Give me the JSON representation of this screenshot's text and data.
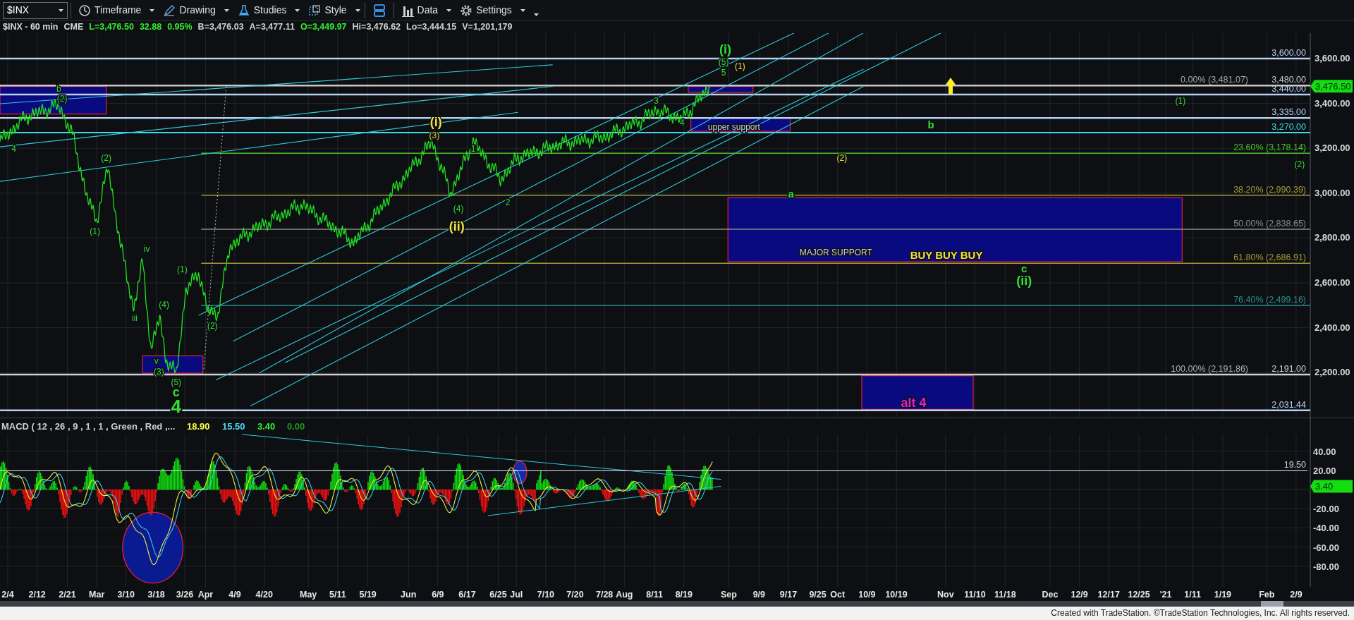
{
  "toolbar": {
    "symbol": "$INX",
    "buttons": [
      {
        "label": "Timeframe"
      },
      {
        "label": "Drawing"
      },
      {
        "label": "Studies"
      },
      {
        "label": "Style"
      },
      {
        "label": "Data"
      },
      {
        "label": "Settings"
      }
    ]
  },
  "quote_bar": {
    "symbol": "$INX - 60 min",
    "exchange": "CME",
    "fields": [
      {
        "text": "L=3,476.50",
        "color": "#33ee33"
      },
      {
        "text": "32.88",
        "color": "#33ee33"
      },
      {
        "text": "0.95%",
        "color": "#33ee33"
      },
      {
        "text": "B=3,476.03",
        "color": "#d0d0d0"
      },
      {
        "text": "A=3,477.11",
        "color": "#d0d0d0"
      },
      {
        "text": "O=3,449.97",
        "color": "#33ee33"
      },
      {
        "text": "Hi=3,476.62",
        "color": "#d0d0d0"
      },
      {
        "text": "Lo=3,444.15",
        "color": "#d0d0d0"
      },
      {
        "text": "V=1,201,179",
        "color": "#d0d0d0"
      }
    ]
  },
  "price_chart": {
    "levels": [
      {
        "label": "3,600.00",
        "color": "#b8d0f0"
      },
      {
        "label": "3,480.00",
        "color": "#c8c8c8"
      },
      {
        "label": "3,440.00",
        "color": "#b8d0f0"
      },
      {
        "label": "3,335.00",
        "color": "#b8d0f0"
      },
      {
        "label": "3,270.00",
        "color": "#40d8e8"
      },
      {
        "label": "2,191.00",
        "color": "#d0d0d0"
      },
      {
        "label": "2,031.44",
        "color": "#b8d0f0"
      }
    ],
    "fib_levels": [
      {
        "label": "0.00% (3,481.07)",
        "color": "#a8a8a8"
      },
      {
        "label": "23.60% (3,178.14)",
        "color": "#4cc02c"
      },
      {
        "label": "38.20% (2,990.39)",
        "color": "#a39a3a"
      },
      {
        "label": "50.00% (2,838.65)",
        "color": "#8a8a8a"
      },
      {
        "label": "61.80% (2,686.91)",
        "color": "#a39a3a"
      },
      {
        "label": "76.40% (2,499.16)",
        "color": "#2a9090"
      },
      {
        "label": "100.00% (2,191.86)",
        "color": "#b0b0b0"
      }
    ],
    "annotations": [
      {
        "text": "4",
        "kind": "small",
        "color": "#33dd33"
      },
      {
        "text": "b",
        "kind": "small",
        "color": "#33dd33"
      },
      {
        "text": "(2)",
        "kind": "small",
        "color": "#33dd33"
      },
      {
        "text": "(2)",
        "kind": "small",
        "color": "#33dd33"
      },
      {
        "text": "(1)",
        "kind": "small",
        "color": "#33dd33"
      },
      {
        "text": "iv",
        "kind": "small",
        "color": "#33dd33"
      },
      {
        "text": "(1)",
        "kind": "small",
        "color": "#33dd33"
      },
      {
        "text": "(4)",
        "kind": "small",
        "color": "#33dd33"
      },
      {
        "text": "iii",
        "kind": "small",
        "color": "#33dd33"
      },
      {
        "text": "v",
        "kind": "small",
        "color": "#33dd33"
      },
      {
        "text": "(3)",
        "kind": "small",
        "color": "#33dd33"
      },
      {
        "text": "(5)",
        "kind": "small",
        "color": "#33dd33"
      },
      {
        "text": "c",
        "kind": "large",
        "color": "#33dd33"
      },
      {
        "text": "4",
        "kind": "xlarge",
        "color": "#33dd33"
      },
      {
        "text": "(2)",
        "kind": "small",
        "color": "#33dd33"
      },
      {
        "text": "(i)",
        "kind": "large",
        "color": "#f0e040"
      },
      {
        "text": "(3)",
        "kind": "small",
        "color": "#d8d040"
      },
      {
        "text": "1",
        "kind": "small",
        "color": "#33dd33"
      },
      {
        "text": "(4)",
        "kind": "small",
        "color": "#33dd33"
      },
      {
        "text": "(ii)",
        "kind": "large",
        "color": "#f0e040"
      },
      {
        "text": "2",
        "kind": "small",
        "color": "#33dd33"
      },
      {
        "text": "3",
        "kind": "small",
        "color": "#33dd33"
      },
      {
        "text": "4",
        "kind": "small",
        "color": "#33dd33"
      },
      {
        "text": "(i)",
        "kind": "large",
        "color": "#33dd33"
      },
      {
        "text": "(5)",
        "kind": "small",
        "color": "#33dd33"
      },
      {
        "text": "5",
        "kind": "small",
        "color": "#33dd33"
      },
      {
        "text": "(1)",
        "kind": "small",
        "color": "#f0e040"
      },
      {
        "text": "upper support",
        "kind": "text",
        "color": "#c8d0e8"
      },
      {
        "text": "b",
        "kind": "bold",
        "color": "#33dd33"
      },
      {
        "text": "(2)",
        "kind": "small",
        "color": "#f0e040"
      },
      {
        "text": "(1)",
        "kind": "small",
        "color": "#33dd33"
      },
      {
        "text": "(2)",
        "kind": "small",
        "color": "#33dd33"
      },
      {
        "text": "a",
        "kind": "bold",
        "color": "#33dd33"
      },
      {
        "text": "MAJOR SUPPORT",
        "kind": "text",
        "color": "#c8d0e8"
      },
      {
        "text": "BUY BUY BUY",
        "kind": "bold",
        "color": "#f0e040"
      },
      {
        "text": "c",
        "kind": "bold",
        "color": "#33dd33"
      },
      {
        "text": "(ii)",
        "kind": "large",
        "color": "#33dd33"
      },
      {
        "text": "alt 4",
        "kind": "large",
        "color": "#e020e0"
      }
    ],
    "price_axis": [
      "3,600.00",
      "3,400.00",
      "3,200.00",
      "3,000.00",
      "2,800.00",
      "2,600.00",
      "2,400.00",
      "2,200.00"
    ],
    "last_price": "3,476.50"
  },
  "macd": {
    "title": "MACD ( 12 , 26 , 9 , 1 , 1 , Green , Red ,...",
    "values": [
      {
        "text": "18.90",
        "color": "#ffff40"
      },
      {
        "text": "15.50",
        "color": "#50d8f0"
      },
      {
        "text": "3.40",
        "color": "#33ee33"
      },
      {
        "text": "0.00",
        "color": "#1a9a1a"
      }
    ],
    "level_label": "19.50",
    "axis": [
      "40.00",
      "20.00",
      "-20.00",
      "-40.00",
      "-60.00",
      "-80.00"
    ],
    "last_value": "3.40"
  },
  "date_axis": [
    "2/4",
    "2/12",
    "2/21",
    "Mar",
    "3/10",
    "3/18",
    "3/26",
    "Apr",
    "4/9",
    "4/20",
    "May",
    "5/11",
    "5/19",
    "Jun",
    "6/9",
    "6/17",
    "6/25",
    "Jul",
    "7/10",
    "7/20",
    "7/28",
    "Aug",
    "8/11",
    "8/19",
    "Sep",
    "9/9",
    "9/17",
    "9/25",
    "Oct",
    "10/9",
    "10/19",
    "Nov",
    "11/10",
    "11/18",
    "Dec",
    "12/9",
    "12/17",
    "12/25",
    "'21",
    "1/11",
    "1/19",
    "Feb",
    "2/9"
  ],
  "footer": "Created with TradeStation. ©TradeStation Technologies, Inc. All rights reserved."
}
